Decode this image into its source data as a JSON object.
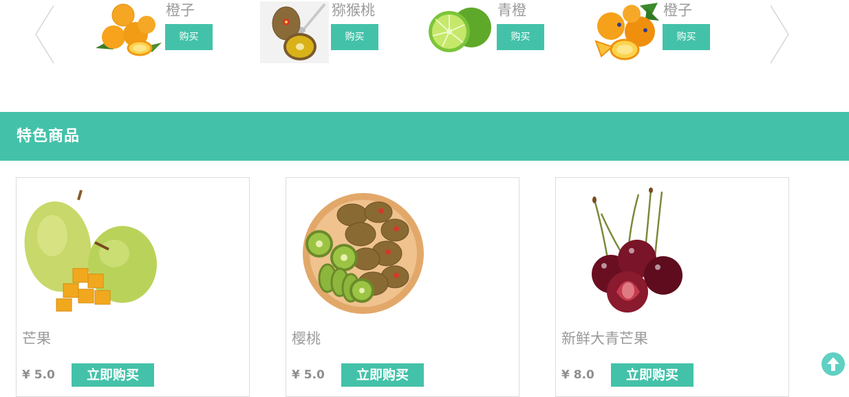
{
  "carousel": {
    "prev_icon": "chevron-left-icon",
    "next_icon": "chevron-right-icon",
    "items": [
      {
        "name": "橙子",
        "buy_label": "购买",
        "image": "orange-image"
      },
      {
        "name": "猕猴桃",
        "buy_label": "购买",
        "image": "kiwi-image"
      },
      {
        "name": "青橙",
        "buy_label": "购买",
        "image": "lime-image"
      },
      {
        "name": "橙子",
        "buy_label": "购买",
        "image": "orange-slices-image"
      }
    ]
  },
  "featured": {
    "title": "特色商品",
    "products": [
      {
        "name": "芒果",
        "price": "¥ 5.0",
        "buy_label": "立即购买",
        "image": "mango-image"
      },
      {
        "name": "樱桃",
        "price": "¥ 5.0",
        "buy_label": "立即购买",
        "image": "kiwi-plate-image"
      },
      {
        "name": "新鲜大青芒果",
        "price": "¥ 8.0",
        "buy_label": "立即购买",
        "image": "cherries-image"
      }
    ]
  },
  "colors": {
    "accent": "#43c2a9",
    "text_gray": "#9a9a9a",
    "to_top": "#5fd0c2"
  },
  "back_to_top_icon": "arrow-up-icon"
}
